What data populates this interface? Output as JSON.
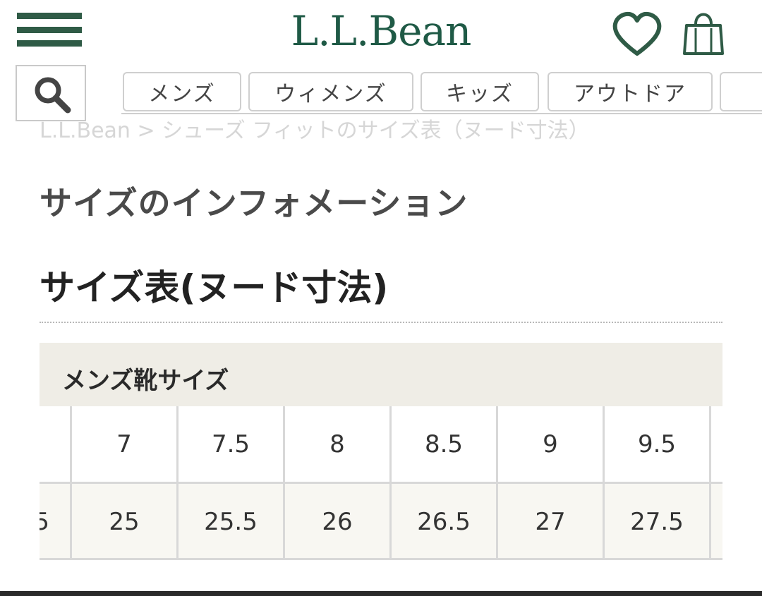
{
  "header": {
    "logo": "L.L.Bean",
    "menu_icon": "hamburger-menu-icon",
    "favorite_icon": "heart-icon",
    "cart_icon": "tote-bag-icon",
    "brand_color": "#2f5b46"
  },
  "search": {
    "icon": "search-icon"
  },
  "nav": {
    "tabs": [
      {
        "label": "メンズ"
      },
      {
        "label": "ウィメンズ"
      },
      {
        "label": "キッズ"
      },
      {
        "label": "アウトドア"
      }
    ]
  },
  "breadcrumb": "L.L.Bean > シューズ フィットのサイズ表（ヌード寸法）",
  "section_title": "サイズのインフォメーション",
  "page_title": "サイズ表(ヌード寸法)",
  "size_table": {
    "caption": "メンズ靴サイズ",
    "us_sizes": [
      "7",
      "7.5",
      "8",
      "8.5",
      "9",
      "9.5"
    ],
    "jp_sizes": [
      "25",
      "25.5",
      "26",
      "26.5",
      "27",
      "27.5"
    ],
    "row2_partial_label": "5",
    "header_bg": "#efede6"
  }
}
